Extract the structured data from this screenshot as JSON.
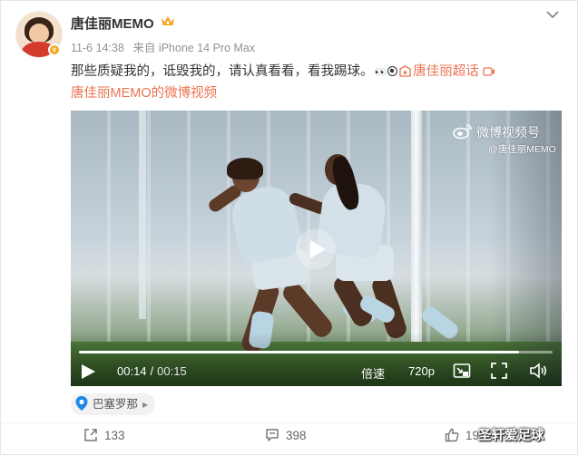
{
  "user": {
    "name": "唐佳丽MEMO",
    "verified_badge": "v"
  },
  "meta": {
    "date": "11-6 14:38",
    "source": "来自 iPhone 14 Pro Max"
  },
  "post": {
    "text": "那些质疑我的，诋毁我的，请认真看看，看我踢球。",
    "emoji_eyes": "👀",
    "topic_link": "唐佳丽超话",
    "video_link": "唐佳丽MEMO的微博视频"
  },
  "video": {
    "watermark": "微博视频号",
    "watermark_sub": "@唐佳丽MEMO",
    "current_time": "00:14",
    "duration": "00:15",
    "time_sep": "/",
    "progress": 0.93,
    "speed_label": "倍速",
    "quality_label": "720p"
  },
  "location": {
    "name": "巴塞罗那"
  },
  "actions": {
    "share_count": "133",
    "comment_count": "398",
    "like_count": "195"
  },
  "overlay_watermark": "圣轩爱足球",
  "colors": {
    "accent": "#eb7350",
    "badge": "#f5a623",
    "location_pin": "#1e88e5"
  }
}
